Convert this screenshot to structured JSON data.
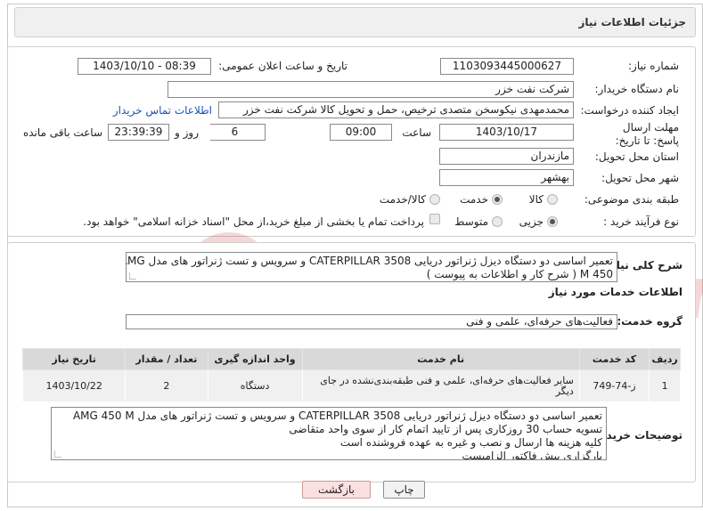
{
  "header": {
    "title": "جزئیات اطلاعات نیاز"
  },
  "need": {
    "need_number_label": "شماره نیاز:",
    "need_number": "1103093445000627",
    "announce_label": "تاریخ و ساعت اعلان عمومی:",
    "announce_value": "1403/10/10 - 08:39",
    "buyer_org_label": "نام دستگاه خریدار:",
    "buyer_org": "شرکت نفت خزر",
    "creator_label": "ایجاد کننده درخواست:",
    "creator": "محمدمهدی نیکوسخن متصدی ترخیص، حمل و تحویل کالا شرکت نفت خزر",
    "contact_link": "اطلاعات تماس خریدار",
    "deadline_label": "مهلت ارسال پاسخ: تا تاریخ:",
    "deadline_date": "1403/10/17",
    "time_label": "ساعت",
    "deadline_time": "09:00",
    "days_value": "6",
    "days_label": "روز و",
    "remaining_time": "23:39:39",
    "remaining_label": "ساعت باقی مانده",
    "province_label": "استان محل تحویل:",
    "province": "مازندران",
    "city_label": "شهر محل تحویل:",
    "city": "بهشهر",
    "category_label": "طبقه بندی موضوعی:",
    "category_options": [
      "کالا",
      "خدمت",
      "کالا/خدمت"
    ],
    "category_selected": "خدمت",
    "process_label": "نوع فرآیند خرید :",
    "process_options": [
      "جزیی",
      "متوسط"
    ],
    "process_selected": "جزیی",
    "payment_note": "پرداخت تمام یا بخشی از مبلغ خرید،از محل \"اسناد خزانه اسلامی\" خواهد بود."
  },
  "details": {
    "summary_label": "شرح کلی نیاز:",
    "summary_line1": "تعمیر اساسی دو دستگاه دیزل ژنراتور دریایی CATERPILLAR 3508   و سرویس و تست ژنراتور های مدل AMG",
    "summary_line2": "450 M ( شرح کار و اطلاعات به پیوست )",
    "services_heading": "اطلاعات خدمات مورد نیاز",
    "service_group_label": "گروه خدمت:",
    "service_group": "فعالیت‌های حرفه‌ای، علمی و فنی",
    "table": {
      "headers": [
        "ردیف",
        "کد خدمت",
        "نام خدمت",
        "واحد اندازه گیری",
        "تعداد / مقدار",
        "تاریخ نیاز"
      ],
      "rows": [
        [
          "1",
          "ز-74-749",
          "سایر فعالیت‌های حرفه‌ای، علمی و فنی طبقه‌بندی‌نشده در جای دیگر",
          "دستگاه",
          "2",
          "1403/10/22"
        ]
      ]
    },
    "buyer_notes_label": "توضیحات خریدار:",
    "buyer_notes": [
      "تعمیر اساسی دو دستگاه دیزل ژنراتور دریایی CATERPILLAR 3508   و سرویس و تست ژنراتور های مدل AMG 450 M",
      "تسویه حساب 30 روزکاری پس از تایید اتمام کار از سوی واحد متقاضی",
      "کلیه هزینه ها ارسال و نصب و غیره به عهده فروشنده است",
      "بارگزاری پیش فاکتور الزامیست"
    ]
  },
  "buttons": {
    "print": "چاپ",
    "back": "بازگشت"
  },
  "watermark": {
    "text": "AriaTender.neT"
  },
  "colors": {
    "link": "#1a55b8",
    "watermark": "#c51a1a",
    "back_button": "#fbe0e0"
  }
}
